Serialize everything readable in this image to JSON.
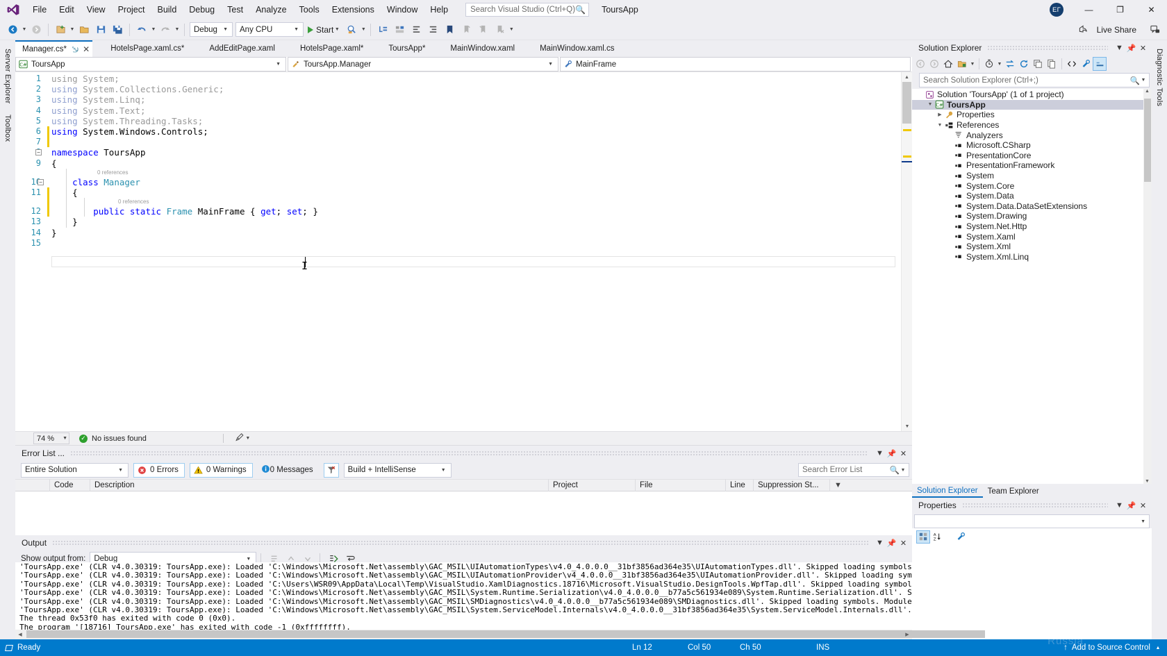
{
  "titlebar": {
    "menus": [
      "File",
      "Edit",
      "View",
      "Project",
      "Build",
      "Debug",
      "Test",
      "Analyze",
      "Tools",
      "Extensions",
      "Window",
      "Help"
    ],
    "search_placeholder": "Search Visual Studio (Ctrl+Q)",
    "solution_name": "ToursApp",
    "avatar_initials": "ЕГ",
    "minimize": "—",
    "maximize": "❐",
    "close": "✕"
  },
  "toolbar": {
    "config": "Debug",
    "platform": "Any CPU",
    "start_label": "Start",
    "live_share_label": "Live Share"
  },
  "rails": {
    "left": [
      "Server Explorer",
      "Toolbox"
    ],
    "right": [
      "Diagnostic Tools"
    ]
  },
  "tabs": [
    {
      "label": "Manager.cs*",
      "active": true,
      "pinned": true,
      "closable": true
    },
    {
      "label": "HotelsPage.xaml.cs*",
      "active": false
    },
    {
      "label": "AddEditPage.xaml",
      "active": false
    },
    {
      "label": "HotelsPage.xaml*",
      "active": false
    },
    {
      "label": "ToursApp*",
      "active": false
    },
    {
      "label": "MainWindow.xaml",
      "active": false
    },
    {
      "label": "MainWindow.xaml.cs",
      "active": false
    }
  ],
  "navbar": {
    "project": "ToursApp",
    "type": "ToursApp.Manager",
    "member": "MainFrame"
  },
  "editor": {
    "zoom": "74 %",
    "issues": "No issues found",
    "line_count": 15,
    "reference_hints": [
      {
        "line": 10,
        "text": "0 references"
      },
      {
        "line": 12,
        "text": "0 references"
      }
    ],
    "lines": [
      {
        "n": 1,
        "segments": [
          {
            "t": "using System;",
            "c": "fade"
          }
        ],
        "faded": true
      },
      {
        "n": 2,
        "segments": [
          {
            "t": "using ",
            "c": "fadek"
          },
          {
            "t": "System.Collections.Generic;",
            "c": "fade"
          }
        ]
      },
      {
        "n": 3,
        "segments": [
          {
            "t": "using ",
            "c": "fadek"
          },
          {
            "t": "System.Linq;",
            "c": "fade"
          }
        ]
      },
      {
        "n": 4,
        "segments": [
          {
            "t": "using ",
            "c": "fadek"
          },
          {
            "t": "System.Text;",
            "c": "fade"
          }
        ]
      },
      {
        "n": 5,
        "segments": [
          {
            "t": "using ",
            "c": "fadek"
          },
          {
            "t": "System.Threading.Tasks;",
            "c": "fade"
          }
        ]
      },
      {
        "n": 6,
        "segments": [
          {
            "t": "using ",
            "c": "k"
          },
          {
            "t": "System.Windows.Controls;",
            "c": "ns"
          }
        ]
      },
      {
        "n": 7,
        "segments": []
      },
      {
        "n": 8,
        "segments": [
          {
            "t": "namespace ",
            "c": "k"
          },
          {
            "t": "ToursApp",
            "c": "ns"
          }
        ]
      },
      {
        "n": 9,
        "segments": [
          {
            "t": "{",
            "c": "ns"
          }
        ]
      },
      {
        "n": 10,
        "segments": [
          {
            "t": "    class ",
            "c": "k"
          },
          {
            "t": "Manager",
            "c": "t"
          }
        ]
      },
      {
        "n": 11,
        "segments": [
          {
            "t": "    {",
            "c": "ns"
          }
        ]
      },
      {
        "n": 12,
        "segments": [
          {
            "t": "        public static ",
            "c": "k"
          },
          {
            "t": "Frame",
            "c": "t"
          },
          {
            "t": " MainFrame { ",
            "c": "ns"
          },
          {
            "t": "get",
            "c": "k"
          },
          {
            "t": "; ",
            "c": "ns"
          },
          {
            "t": "set",
            "c": "k"
          },
          {
            "t": "; }",
            "c": "ns"
          }
        ]
      },
      {
        "n": 13,
        "segments": [
          {
            "t": "    }",
            "c": "ns"
          }
        ]
      },
      {
        "n": 14,
        "segments": [
          {
            "t": "}",
            "c": "ns"
          }
        ]
      },
      {
        "n": 15,
        "segments": []
      }
    ]
  },
  "solution_explorer": {
    "title": "Solution Explorer",
    "search_placeholder": "Search Solution Explorer (Ctrl+;)",
    "tree": [
      {
        "label": "Solution 'ToursApp' (1 of 1 project)",
        "depth": 0,
        "arrow": "",
        "icon": "solution-icon",
        "bold": false,
        "selected": false
      },
      {
        "label": "ToursApp",
        "depth": 1,
        "arrow": "▼",
        "icon": "csharp-project-icon",
        "bold": true,
        "selected": true
      },
      {
        "label": "Properties",
        "depth": 2,
        "arrow": "▶",
        "icon": "wrench-icon",
        "bold": false,
        "selected": false
      },
      {
        "label": "References",
        "depth": 2,
        "arrow": "▼",
        "icon": "references-icon",
        "bold": false,
        "selected": false
      },
      {
        "label": "Analyzers",
        "depth": 3,
        "arrow": "",
        "icon": "analyzers-icon",
        "bold": false,
        "selected": false
      },
      {
        "label": "Microsoft.CSharp",
        "depth": 3,
        "arrow": "",
        "icon": "reference-icon",
        "bold": false,
        "selected": false
      },
      {
        "label": "PresentationCore",
        "depth": 3,
        "arrow": "",
        "icon": "reference-icon",
        "bold": false,
        "selected": false
      },
      {
        "label": "PresentationFramework",
        "depth": 3,
        "arrow": "",
        "icon": "reference-icon",
        "bold": false,
        "selected": false
      },
      {
        "label": "System",
        "depth": 3,
        "arrow": "",
        "icon": "reference-icon",
        "bold": false,
        "selected": false
      },
      {
        "label": "System.Core",
        "depth": 3,
        "arrow": "",
        "icon": "reference-icon",
        "bold": false,
        "selected": false
      },
      {
        "label": "System.Data",
        "depth": 3,
        "arrow": "",
        "icon": "reference-icon",
        "bold": false,
        "selected": false
      },
      {
        "label": "System.Data.DataSetExtensions",
        "depth": 3,
        "arrow": "",
        "icon": "reference-icon",
        "bold": false,
        "selected": false
      },
      {
        "label": "System.Drawing",
        "depth": 3,
        "arrow": "",
        "icon": "reference-icon",
        "bold": false,
        "selected": false
      },
      {
        "label": "System.Net.Http",
        "depth": 3,
        "arrow": "",
        "icon": "reference-icon",
        "bold": false,
        "selected": false
      },
      {
        "label": "System.Xaml",
        "depth": 3,
        "arrow": "",
        "icon": "reference-icon",
        "bold": false,
        "selected": false
      },
      {
        "label": "System.Xml",
        "depth": 3,
        "arrow": "",
        "icon": "reference-icon",
        "bold": false,
        "selected": false
      },
      {
        "label": "System.Xml.Linq",
        "depth": 3,
        "arrow": "",
        "icon": "reference-icon",
        "bold": false,
        "selected": false
      }
    ],
    "bottom_tabs": [
      {
        "label": "Solution Explorer",
        "active": true
      },
      {
        "label": "Team Explorer",
        "active": false
      }
    ]
  },
  "properties": {
    "title": "Properties"
  },
  "error_list": {
    "title": "Error List ...",
    "scope": "Entire Solution",
    "errors": "0 Errors",
    "warnings": "0 Warnings",
    "messages": "0 Messages",
    "build_filter": "Build + IntelliSense",
    "search_placeholder": "Search Error List",
    "columns": [
      "",
      "Code",
      "Description",
      "Project",
      "File",
      "Line",
      "Suppression St..."
    ]
  },
  "output": {
    "title": "Output",
    "show_from_label": "Show output from:",
    "source": "Debug",
    "lines": [
      "'ToursApp.exe' (CLR v4.0.30319: ToursApp.exe): Loaded 'C:\\Windows\\Microsoft.Net\\assembly\\GAC_MSIL\\UIAutomationTypes\\v4.0_4.0.0.0__31bf3856ad364e35\\UIAutomationTypes.dll'. Skipped loading symbols. Module is optimized and the debugger option 'Just My Code' is en",
      "'ToursApp.exe' (CLR v4.0.30319: ToursApp.exe): Loaded 'C:\\Windows\\Microsoft.Net\\assembly\\GAC_MSIL\\UIAutomationProvider\\v4_4.0.0.0__31bf3856ad364e35\\UIAutomationProvider.dll'. Skipped loading symbols. Module is optimized and the debugger option 'Just My Code'",
      "'ToursApp.exe' (CLR v4.0.30319: ToursApp.exe): Loaded 'C:\\Users\\WSR09\\AppData\\Local\\Temp\\VisualStudio.XamlDiagnostics.18716\\Microsoft.VisualStudio.DesignTools.WpfTap.dll'. Skipped loading symbols. Module is optimized and the debugger option 'Just My Code' is er",
      "'ToursApp.exe' (CLR v4.0.30319: ToursApp.exe): Loaded 'C:\\Windows\\Microsoft.Net\\assembly\\GAC_MSIL\\System.Runtime.Serialization\\v4.0_4.0.0.0__b77a5c561934e089\\System.Runtime.Serialization.dll'. Skipped loading symbols. Module is optimized and the debugger option",
      "'ToursApp.exe' (CLR v4.0.30319: ToursApp.exe): Loaded 'C:\\Windows\\Microsoft.Net\\assembly\\GAC_MSIL\\SMDiagnostics\\v4.0_4.0.0.0__b77a5c561934e089\\SMDiagnostics.dll'. Skipped loading symbols. Module is optimized and the debugger option 'Just My Code' is enabled.",
      "'ToursApp.exe' (CLR v4.0.30319: ToursApp.exe): Loaded 'C:\\Windows\\Microsoft.Net\\assembly\\GAC_MSIL\\System.ServiceModel.Internals\\v4.0_4.0.0.0__31bf3856ad364e35\\System.ServiceModel.Internals.dll'. Skipped loading symbols. Module is optimized and the debugger opti",
      "The thread 0x53f0 has exited with code 0 (0x0).",
      "The program '[18716] ToursApp.exe' has exited with code -1 (0xffffffff)."
    ]
  },
  "statusbar": {
    "ready": "Ready",
    "line": "Ln 12",
    "col": "Col 50",
    "ch": "Ch 50",
    "ins": "INS",
    "source_control": "Add to Source Control",
    "watermark": "Russia"
  },
  "colors": {
    "accent": "#007acc",
    "tab_active_border": "#0e70c0",
    "keyword": "#0000ff",
    "type": "#2b91af",
    "linenum": "#2b91af",
    "ok_green": "#2ea02e",
    "error_red": "#e81123",
    "warn_yellow": "#f0c800"
  }
}
